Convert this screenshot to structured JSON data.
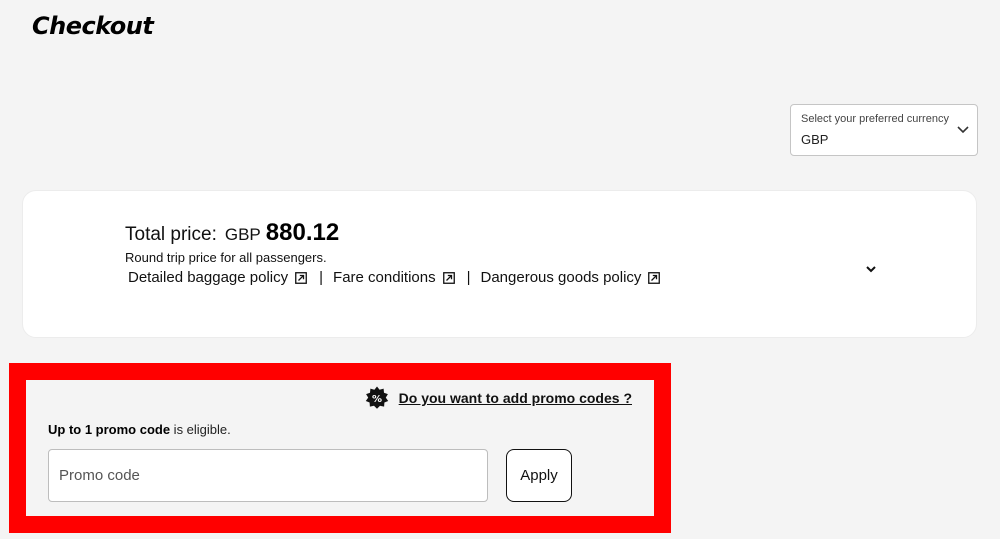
{
  "header": {
    "title": "Checkout"
  },
  "currency": {
    "label": "Select your preferred currency",
    "value": "GBP"
  },
  "price": {
    "label": "Total price:",
    "currency": "GBP",
    "amount": "880.12",
    "note": "Round trip price for all passengers.",
    "links": [
      "Detailed baggage policy",
      "Fare conditions",
      "Dangerous goods policy"
    ],
    "separator": "|"
  },
  "promo": {
    "toggle_label": "Do you want to add promo codes ?",
    "eligible_bold": "Up to 1 promo code",
    "eligible_rest": " is eligible.",
    "input_placeholder": "Promo code",
    "input_value": "",
    "apply_label": "Apply",
    "badge_symbol": "%"
  },
  "colors": {
    "highlight": "#ff0000",
    "background": "#f4f4f4"
  },
  "icons": [
    "chevron-down-icon",
    "external-link-icon",
    "discount-badge-icon"
  ]
}
